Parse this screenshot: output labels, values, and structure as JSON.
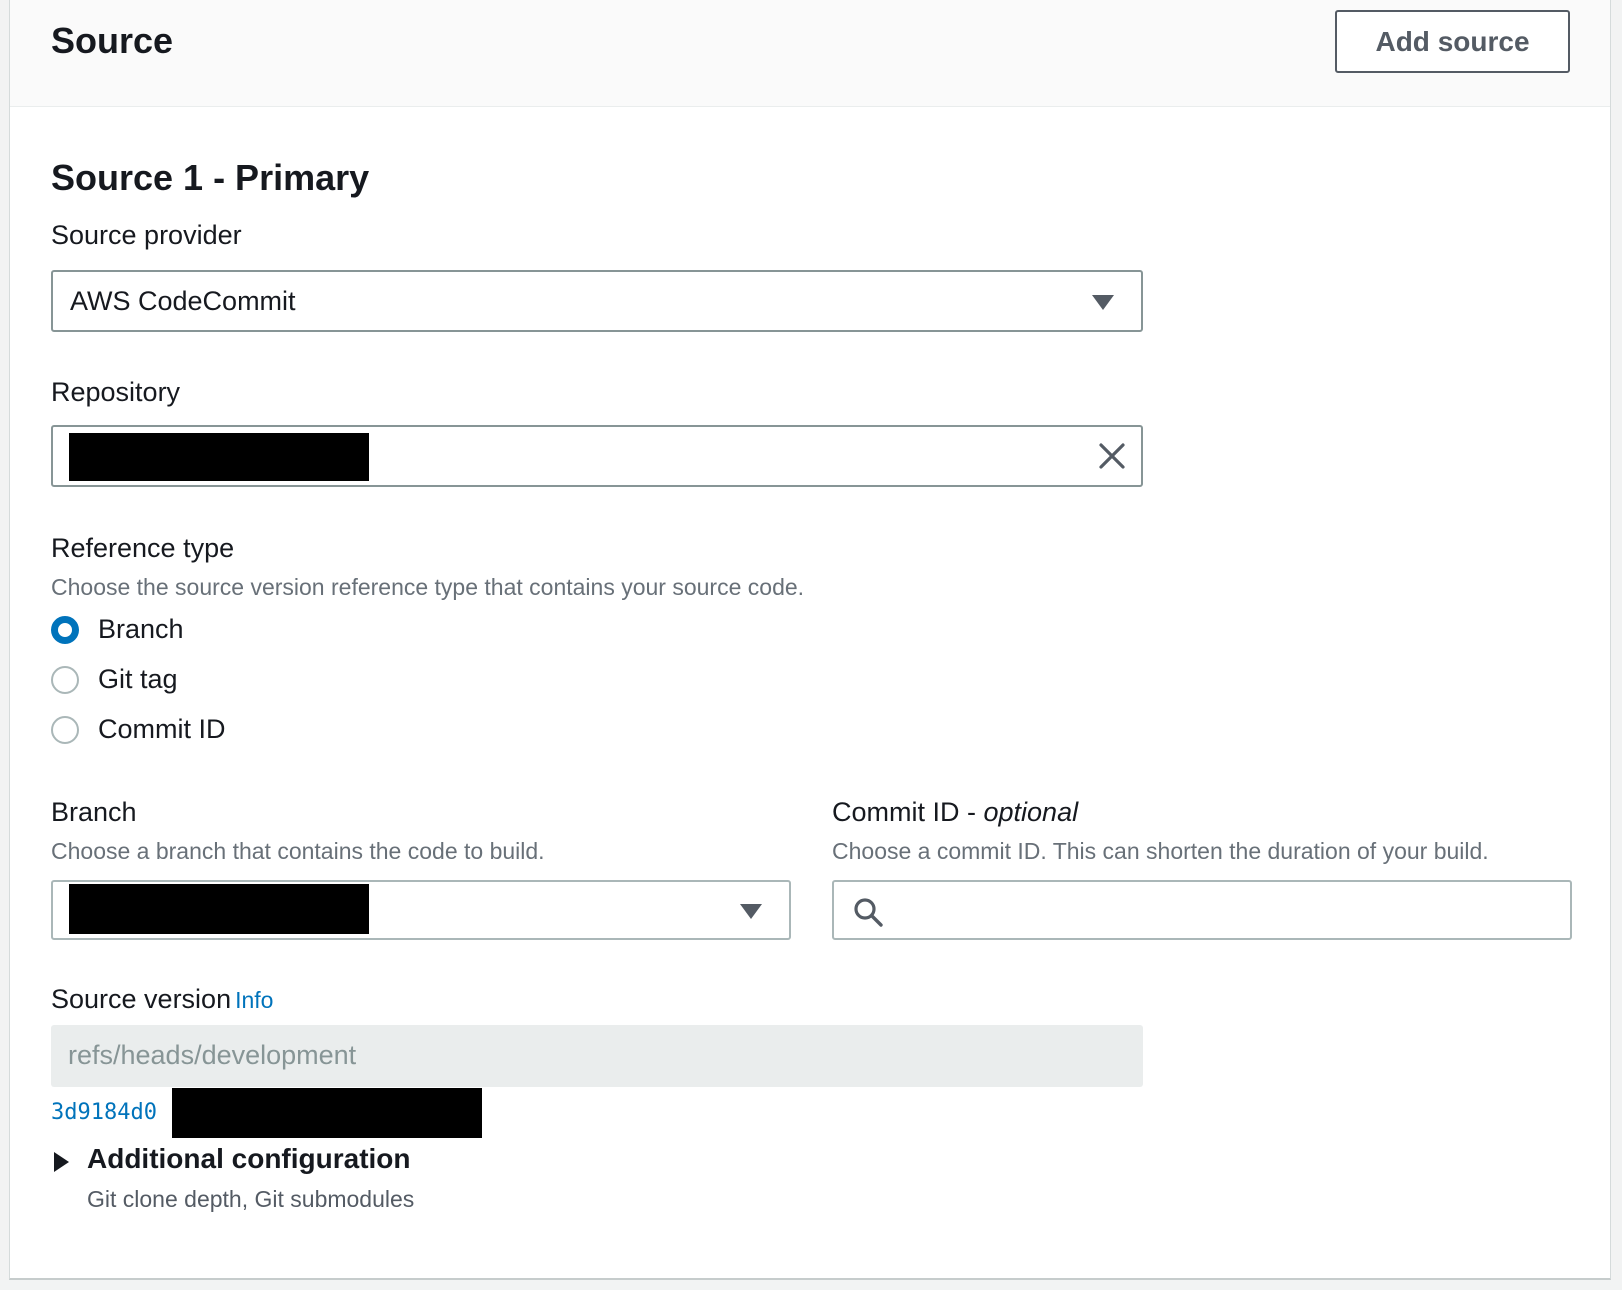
{
  "header": {
    "title": "Source",
    "add_source_label": "Add source"
  },
  "primary": {
    "title": "Source 1 - Primary",
    "source_provider": {
      "label": "Source provider",
      "value": "AWS CodeCommit"
    },
    "repository": {
      "label": "Repository",
      "value": "[redacted]"
    },
    "reference_type": {
      "label": "Reference type",
      "description": "Choose the source version reference type that contains your source code.",
      "options": [
        {
          "label": "Branch",
          "selected": true
        },
        {
          "label": "Git tag",
          "selected": false
        },
        {
          "label": "Commit ID",
          "selected": false
        }
      ]
    },
    "branch": {
      "label": "Branch",
      "description": "Choose a branch that contains the code to build.",
      "value": "[redacted]"
    },
    "commit_id": {
      "label": "Commit ID - ",
      "label_optional": "optional",
      "description": "Choose a commit ID. This can shorten the duration of your build.",
      "value": ""
    },
    "source_version": {
      "label": "Source version",
      "info_label": "Info",
      "value": "refs/heads/development",
      "commit_link": "3d9184d0"
    },
    "additional_configuration": {
      "label": "Additional configuration",
      "description": "Git clone depth, Git submodules"
    }
  },
  "icons": {
    "dropdown": "caret-down-icon",
    "clear": "close-icon",
    "search": "search-icon",
    "expand": "caret-right-icon"
  },
  "colors": {
    "accent": "#0073bb",
    "border": "#aab7b8",
    "muted_text": "#687078",
    "readonly_bg": "#eaeded"
  }
}
